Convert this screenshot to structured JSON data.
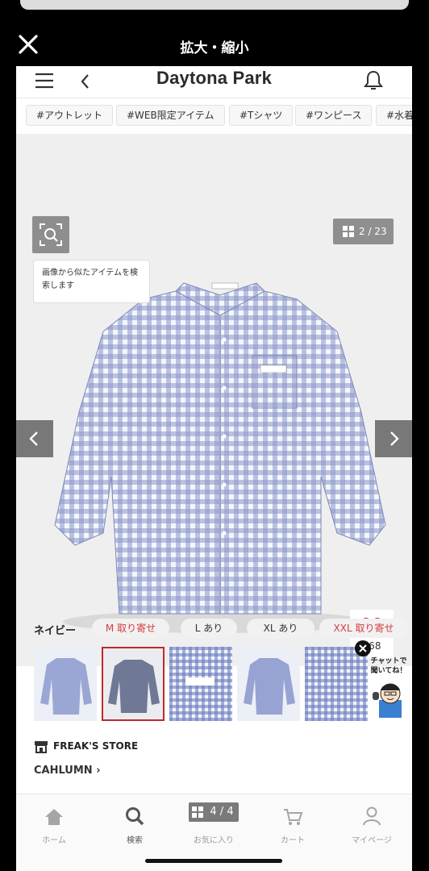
{
  "viewer": {
    "title": "拡大・縮小"
  },
  "header": {
    "logo": "Daytona Park"
  },
  "tags": [
    "#アウトレット",
    "#WEB限定アイテム",
    "#Tシャツ",
    "#ワンピース",
    "#水着"
  ],
  "hero": {
    "lens_tip": "画像から似たアイテムを検索します",
    "counter": "2 / 23",
    "favorite_count": "368"
  },
  "variants": {
    "color": "ネイビー",
    "sizes": [
      {
        "label": "M 取り寄せ",
        "color": "#d63a3f"
      },
      {
        "label": "L あり",
        "color": "#333333"
      },
      {
        "label": "XL あり",
        "color": "#333333"
      },
      {
        "label": "XXL 取り寄せ",
        "color": "#d63a3f"
      }
    ]
  },
  "chat": {
    "text": "チャットで聞いてね！"
  },
  "store": {
    "name": "FREAK'S STORE",
    "brand": "CAHLUMN ›"
  },
  "tabbar": {
    "home": "ホーム",
    "search": "検索",
    "favorites_count": "4 / 4",
    "favorites": "お気に入り",
    "cart": "カート",
    "mypage": "マイページ"
  },
  "colors": {
    "accent_red": "#c0282e",
    "heart": "#e0202e"
  }
}
